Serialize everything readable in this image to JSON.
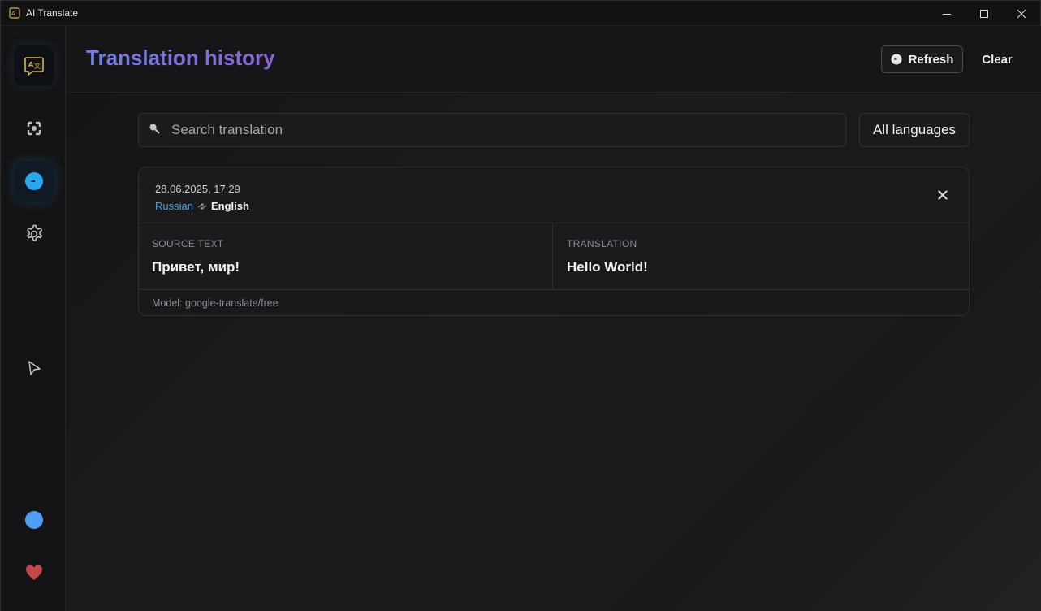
{
  "window": {
    "title": "AI Translate"
  },
  "sidebar": {
    "items": [
      {
        "name": "translate",
        "icon": "translate-icon"
      },
      {
        "name": "ocr",
        "icon": "ocr-scan-icon"
      },
      {
        "name": "history",
        "icon": "history-icon",
        "active": true
      },
      {
        "name": "settings",
        "icon": "gear-icon"
      },
      {
        "name": "pointer",
        "icon": "cursor-icon"
      },
      {
        "name": "status",
        "icon": "status-dot-icon",
        "color": "#4f9cf5"
      },
      {
        "name": "favorites",
        "icon": "heart-icon",
        "color": "#c0484a"
      }
    ]
  },
  "header": {
    "title": "Translation history",
    "refresh_label": "Refresh",
    "clear_label": "Clear"
  },
  "search": {
    "placeholder": "Search translation"
  },
  "filter": {
    "language_label": "All languages"
  },
  "history": [
    {
      "date": "28.06.2025, 17:29",
      "source_lang": "Russian",
      "target_lang": "English",
      "source_label": "SOURCE TEXT",
      "source_text": "Привет, мир!",
      "translation_label": "TRANSLATION",
      "translation_text": "Hello World!",
      "model": "Model: google-translate/free"
    }
  ],
  "colors": {
    "accent_blue": "#3ba7e8",
    "title_gradient_start": "#6f7fe6",
    "title_gradient_end": "#8b62d6"
  }
}
